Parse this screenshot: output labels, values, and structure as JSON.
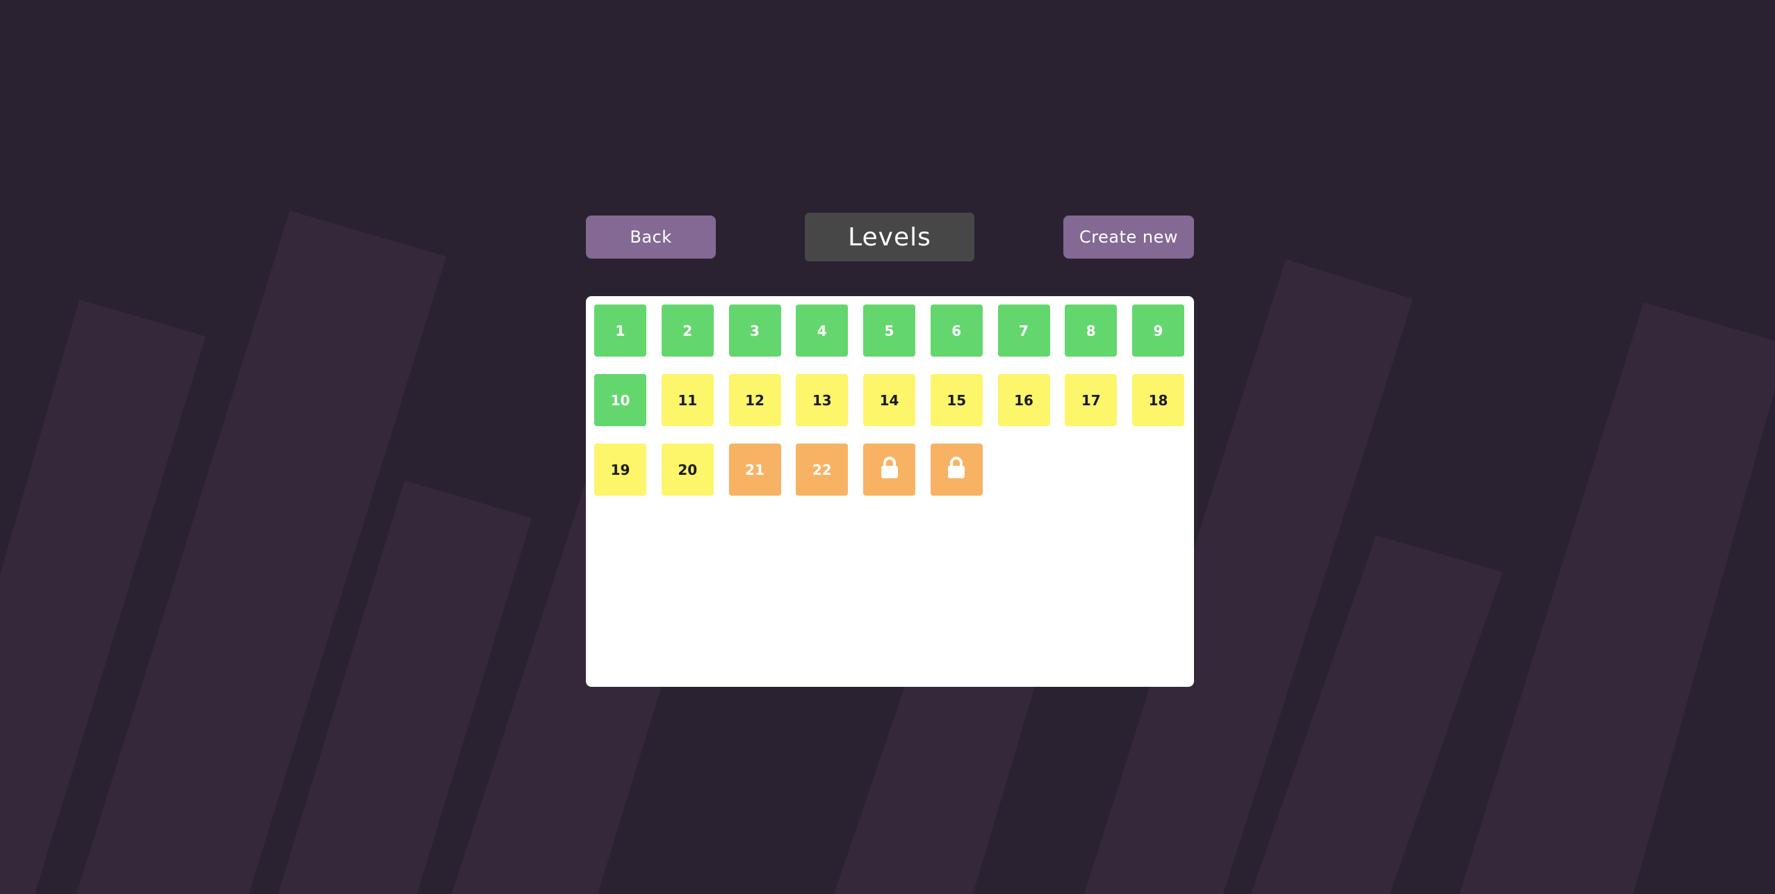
{
  "header": {
    "back_label": "Back",
    "title": "Levels",
    "create_label": "Create new"
  },
  "colors": {
    "background": "#2a2230",
    "stripes": "#35283a",
    "button": "#836993",
    "title_box": "#474747",
    "panel": "#ffffff",
    "completed": "#63d76d",
    "in_progress": "#fdf56a",
    "unlocked": "#f8b263"
  },
  "levels": [
    {
      "label": "1",
      "status": "completed"
    },
    {
      "label": "2",
      "status": "completed"
    },
    {
      "label": "3",
      "status": "completed"
    },
    {
      "label": "4",
      "status": "completed"
    },
    {
      "label": "5",
      "status": "completed"
    },
    {
      "label": "6",
      "status": "completed"
    },
    {
      "label": "7",
      "status": "completed"
    },
    {
      "label": "8",
      "status": "completed"
    },
    {
      "label": "9",
      "status": "completed"
    },
    {
      "label": "10",
      "status": "completed"
    },
    {
      "label": "11",
      "status": "in_progress"
    },
    {
      "label": "12",
      "status": "in_progress"
    },
    {
      "label": "13",
      "status": "in_progress"
    },
    {
      "label": "14",
      "status": "in_progress"
    },
    {
      "label": "15",
      "status": "in_progress"
    },
    {
      "label": "16",
      "status": "in_progress"
    },
    {
      "label": "17",
      "status": "in_progress"
    },
    {
      "label": "18",
      "status": "in_progress"
    },
    {
      "label": "19",
      "status": "in_progress"
    },
    {
      "label": "20",
      "status": "in_progress"
    },
    {
      "label": "21",
      "status": "unlocked"
    },
    {
      "label": "22",
      "status": "unlocked"
    },
    {
      "label": "",
      "status": "locked",
      "icon": "lock-icon"
    },
    {
      "label": "",
      "status": "locked",
      "icon": "lock-icon"
    }
  ]
}
